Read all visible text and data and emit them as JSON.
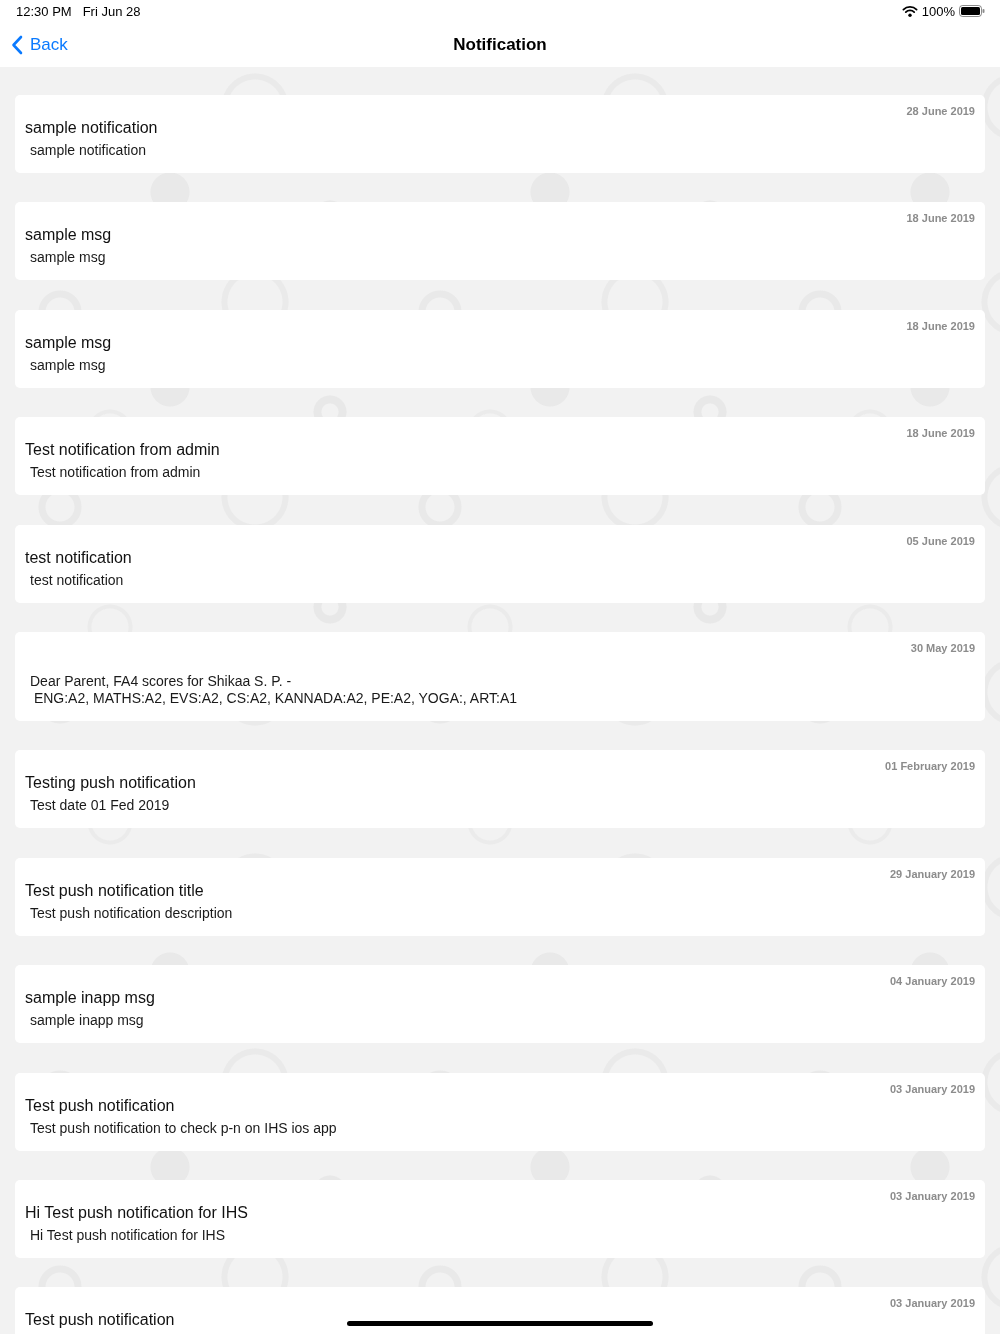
{
  "status_bar": {
    "time": "12:30 PM",
    "date": "Fri Jun 28",
    "battery": "100%"
  },
  "nav_bar": {
    "back": "Back",
    "title": "Notification"
  },
  "notifications": [
    {
      "date": "28 June 2019",
      "title": "sample notification",
      "description": "sample notification"
    },
    {
      "date": "18 June 2019",
      "title": "sample msg",
      "description": "sample msg"
    },
    {
      "date": "18 June 2019",
      "title": "sample msg",
      "description": "sample msg"
    },
    {
      "date": "18 June 2019",
      "title": "Test notification from admin",
      "description": "Test notification from admin"
    },
    {
      "date": "05 June 2019",
      "title": "test notification",
      "description": "test notification"
    },
    {
      "date": "30 May 2019",
      "description": "Dear Parent, FA4 scores for Shikaa S. P. -\n ENG:A2, MATHS:A2, EVS:A2, CS:A2, KANNADA:A2, PE:A2, YOGA:, ART:A1"
    },
    {
      "date": "01 February 2019",
      "title": "Testing push notification",
      "description": "Test date 01 Fed 2019"
    },
    {
      "date": "29 January 2019",
      "title": "Test push notification title",
      "description": "Test push notification description"
    },
    {
      "date": "04 January 2019",
      "title": "sample inapp msg",
      "description": "sample inapp msg"
    },
    {
      "date": "03 January 2019",
      "title": "Test push notification",
      "description": "Test push notification to check p-n on IHS ios app"
    },
    {
      "date": "03 January 2019",
      "title": "Hi Test push notification for IHS",
      "description": "Hi Test push notification for IHS"
    },
    {
      "date": "03 January 2019",
      "title": "Test push notification"
    }
  ]
}
